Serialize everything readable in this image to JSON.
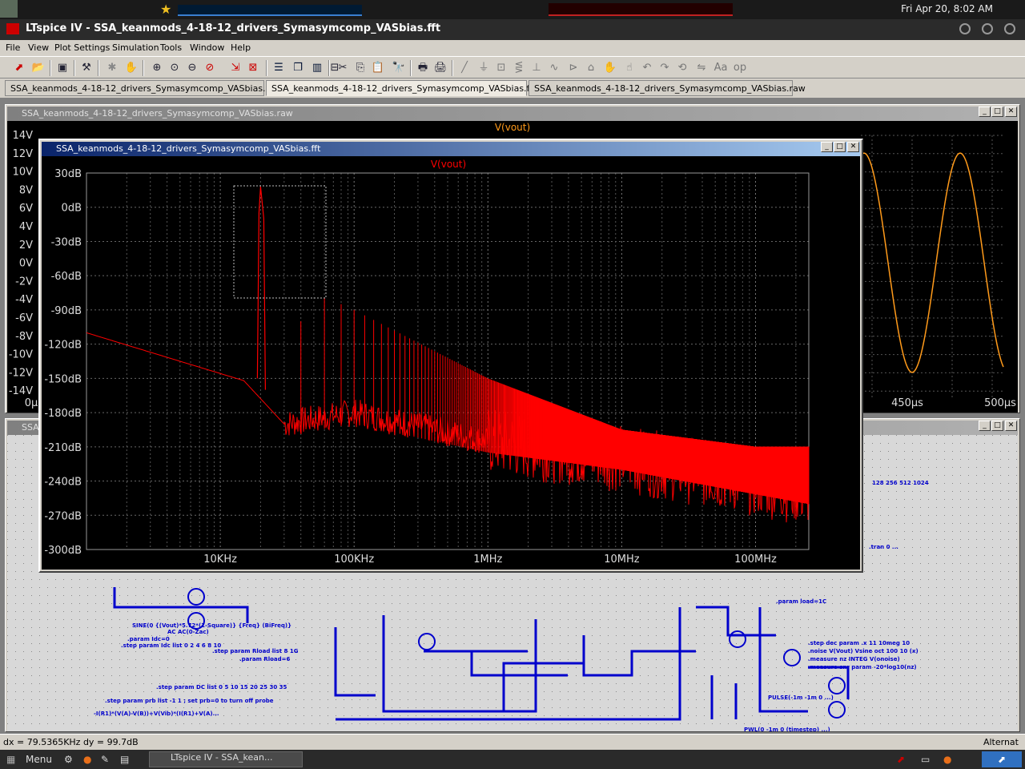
{
  "system_panel": {
    "clock": "Fri Apr 20,  8:02 AM"
  },
  "app": {
    "title": "LTspice IV - SSA_keanmods_4-18-12_drivers_Symasymcomp_VASbias.fft"
  },
  "menu": [
    "File",
    "View",
    "Plot Settings",
    "Simulation",
    "Tools",
    "Window",
    "Help"
  ],
  "tabs": [
    {
      "label": "SSA_keanmods_4-18-12_drivers_Symasymcomp_VASbias.asc"
    },
    {
      "label": "SSA_keanmods_4-18-12_drivers_Symasymcomp_VASbias.fft"
    },
    {
      "label": "SSA_keanmods_4-18-12_drivers_Symasymcomp_VASbias.raw"
    }
  ],
  "raw_window": {
    "title": "SSA_keanmods_4-18-12_drivers_Symasymcomp_VASbias.raw",
    "trace": "V(vout)",
    "y_ticks": [
      "14V",
      "12V",
      "10V",
      "8V",
      "6V",
      "4V",
      "2V",
      "0V",
      "-2V",
      "-4V",
      "-6V",
      "-8V",
      "-10V",
      "-12V",
      "-14V"
    ],
    "x_ticks": [
      "0μ",
      "450μs",
      "500μs"
    ],
    "trace_color": "#ff9a1a"
  },
  "fft_window": {
    "title": "SSA_keanmods_4-18-12_drivers_Symasymcomp_VASbias.fft",
    "trace": "V(vout)",
    "trace_color": "#ff0000"
  },
  "schematic_window": {
    "title": "SSA"
  },
  "chart_data": {
    "type": "line",
    "title": "V(vout)",
    "xlabel": "",
    "ylabel": "",
    "x_scale": "log",
    "x_ticks": [
      "10KHz",
      "100KHz",
      "1MHz",
      "10MHz",
      "100MHz"
    ],
    "y_ticks": [
      "30dB",
      "0dB",
      "-30dB",
      "-60dB",
      "-90dB",
      "-120dB",
      "-150dB",
      "-180dB",
      "-210dB",
      "-240dB",
      "-270dB",
      "-300dB"
    ],
    "xlim_hz": [
      1000,
      250000000
    ],
    "ylim": [
      -300,
      30
    ],
    "grid": true,
    "series": [
      {
        "name": "V(vout)",
        "peaks": [
          {
            "f": 20000,
            "db": 18
          },
          {
            "f": 40000,
            "db": -100
          },
          {
            "f": 60000,
            "db": -80
          },
          {
            "f": 80000,
            "db": -85
          },
          {
            "f": 100000,
            "db": -90
          },
          {
            "f": 1000000,
            "db": -150
          },
          {
            "f": 10000000,
            "db": -195
          },
          {
            "f": 100000000,
            "db": -210
          }
        ],
        "floor": [
          {
            "f": 1000,
            "db": -110
          },
          {
            "f": 5000,
            "db": -135
          },
          {
            "f": 15000,
            "db": -152
          },
          {
            "f": 30000,
            "db": -190
          },
          {
            "f": 100000,
            "db": -180
          },
          {
            "f": 1000000,
            "db": -205
          },
          {
            "f": 10000000,
            "db": -220
          },
          {
            "f": 250000000,
            "db": -250
          }
        ]
      }
    ]
  },
  "status": {
    "cursor": "dx = 79.5365KHz  dy = 99.7dB",
    "right": "Alternat"
  },
  "taskbar": {
    "menu": "Menu",
    "task": "LTspice IV - SSA_kean..."
  }
}
